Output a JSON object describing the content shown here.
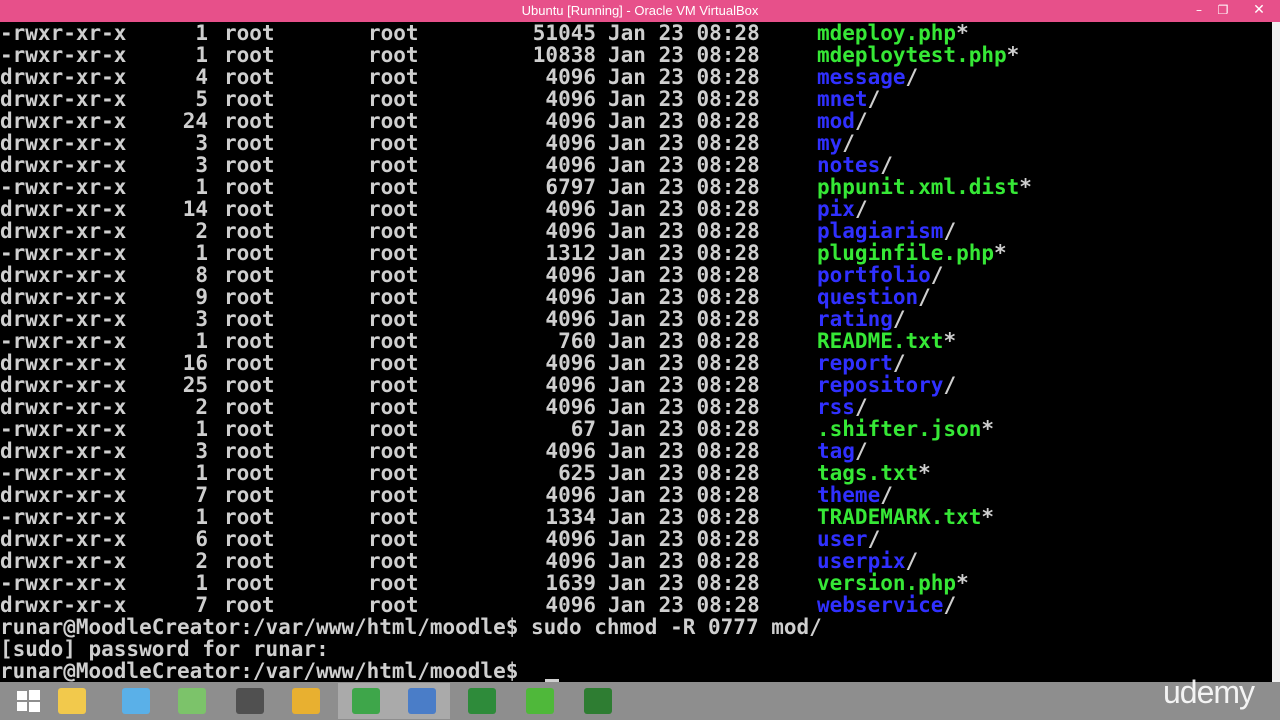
{
  "window": {
    "title": "Ubuntu [Running] - Oracle VM VirtualBox",
    "minimize_glyph": "–",
    "restore_glyph": "❐",
    "close_glyph": "✕"
  },
  "terminal": {
    "colors": {
      "directory": "#3030ff",
      "executable": "#36e836",
      "text": "#cfcfcf"
    },
    "listing": [
      {
        "perm": "-rwxr-xr-x",
        "links": "1",
        "owner": "root",
        "group": "root",
        "size": "51045",
        "date": "Jan 23 08:28",
        "name": "mdeploy.php",
        "suffix": "*",
        "type": "exec"
      },
      {
        "perm": "-rwxr-xr-x",
        "links": "1",
        "owner": "root",
        "group": "root",
        "size": "10838",
        "date": "Jan 23 08:28",
        "name": "mdeploytest.php",
        "suffix": "*",
        "type": "exec"
      },
      {
        "perm": "drwxr-xr-x",
        "links": "4",
        "owner": "root",
        "group": "root",
        "size": "4096",
        "date": "Jan 23 08:28",
        "name": "message",
        "suffix": "/",
        "type": "dir"
      },
      {
        "perm": "drwxr-xr-x",
        "links": "5",
        "owner": "root",
        "group": "root",
        "size": "4096",
        "date": "Jan 23 08:28",
        "name": "mnet",
        "suffix": "/",
        "type": "dir"
      },
      {
        "perm": "drwxr-xr-x",
        "links": "24",
        "owner": "root",
        "group": "root",
        "size": "4096",
        "date": "Jan 23 08:28",
        "name": "mod",
        "suffix": "/",
        "type": "dir"
      },
      {
        "perm": "drwxr-xr-x",
        "links": "3",
        "owner": "root",
        "group": "root",
        "size": "4096",
        "date": "Jan 23 08:28",
        "name": "my",
        "suffix": "/",
        "type": "dir"
      },
      {
        "perm": "drwxr-xr-x",
        "links": "3",
        "owner": "root",
        "group": "root",
        "size": "4096",
        "date": "Jan 23 08:28",
        "name": "notes",
        "suffix": "/",
        "type": "dir"
      },
      {
        "perm": "-rwxr-xr-x",
        "links": "1",
        "owner": "root",
        "group": "root",
        "size": "6797",
        "date": "Jan 23 08:28",
        "name": "phpunit.xml.dist",
        "suffix": "*",
        "type": "exec"
      },
      {
        "perm": "drwxr-xr-x",
        "links": "14",
        "owner": "root",
        "group": "root",
        "size": "4096",
        "date": "Jan 23 08:28",
        "name": "pix",
        "suffix": "/",
        "type": "dir"
      },
      {
        "perm": "drwxr-xr-x",
        "links": "2",
        "owner": "root",
        "group": "root",
        "size": "4096",
        "date": "Jan 23 08:28",
        "name": "plagiarism",
        "suffix": "/",
        "type": "dir"
      },
      {
        "perm": "-rwxr-xr-x",
        "links": "1",
        "owner": "root",
        "group": "root",
        "size": "1312",
        "date": "Jan 23 08:28",
        "name": "pluginfile.php",
        "suffix": "*",
        "type": "exec"
      },
      {
        "perm": "drwxr-xr-x",
        "links": "8",
        "owner": "root",
        "group": "root",
        "size": "4096",
        "date": "Jan 23 08:28",
        "name": "portfolio",
        "suffix": "/",
        "type": "dir"
      },
      {
        "perm": "drwxr-xr-x",
        "links": "9",
        "owner": "root",
        "group": "root",
        "size": "4096",
        "date": "Jan 23 08:28",
        "name": "question",
        "suffix": "/",
        "type": "dir"
      },
      {
        "perm": "drwxr-xr-x",
        "links": "3",
        "owner": "root",
        "group": "root",
        "size": "4096",
        "date": "Jan 23 08:28",
        "name": "rating",
        "suffix": "/",
        "type": "dir"
      },
      {
        "perm": "-rwxr-xr-x",
        "links": "1",
        "owner": "root",
        "group": "root",
        "size": "760",
        "date": "Jan 23 08:28",
        "name": "README.txt",
        "suffix": "*",
        "type": "exec"
      },
      {
        "perm": "drwxr-xr-x",
        "links": "16",
        "owner": "root",
        "group": "root",
        "size": "4096",
        "date": "Jan 23 08:28",
        "name": "report",
        "suffix": "/",
        "type": "dir"
      },
      {
        "perm": "drwxr-xr-x",
        "links": "25",
        "owner": "root",
        "group": "root",
        "size": "4096",
        "date": "Jan 23 08:28",
        "name": "repository",
        "suffix": "/",
        "type": "dir"
      },
      {
        "perm": "drwxr-xr-x",
        "links": "2",
        "owner": "root",
        "group": "root",
        "size": "4096",
        "date": "Jan 23 08:28",
        "name": "rss",
        "suffix": "/",
        "type": "dir"
      },
      {
        "perm": "-rwxr-xr-x",
        "links": "1",
        "owner": "root",
        "group": "root",
        "size": "67",
        "date": "Jan 23 08:28",
        "name": ".shifter.json",
        "suffix": "*",
        "type": "exec"
      },
      {
        "perm": "drwxr-xr-x",
        "links": "3",
        "owner": "root",
        "group": "root",
        "size": "4096",
        "date": "Jan 23 08:28",
        "name": "tag",
        "suffix": "/",
        "type": "dir"
      },
      {
        "perm": "-rwxr-xr-x",
        "links": "1",
        "owner": "root",
        "group": "root",
        "size": "625",
        "date": "Jan 23 08:28",
        "name": "tags.txt",
        "suffix": "*",
        "type": "exec"
      },
      {
        "perm": "drwxr-xr-x",
        "links": "7",
        "owner": "root",
        "group": "root",
        "size": "4096",
        "date": "Jan 23 08:28",
        "name": "theme",
        "suffix": "/",
        "type": "dir"
      },
      {
        "perm": "-rwxr-xr-x",
        "links": "1",
        "owner": "root",
        "group": "root",
        "size": "1334",
        "date": "Jan 23 08:28",
        "name": "TRADEMARK.txt",
        "suffix": "*",
        "type": "exec"
      },
      {
        "perm": "drwxr-xr-x",
        "links": "6",
        "owner": "root",
        "group": "root",
        "size": "4096",
        "date": "Jan 23 08:28",
        "name": "user",
        "suffix": "/",
        "type": "dir"
      },
      {
        "perm": "drwxr-xr-x",
        "links": "2",
        "owner": "root",
        "group": "root",
        "size": "4096",
        "date": "Jan 23 08:28",
        "name": "userpix",
        "suffix": "/",
        "type": "dir"
      },
      {
        "perm": "-rwxr-xr-x",
        "links": "1",
        "owner": "root",
        "group": "root",
        "size": "1639",
        "date": "Jan 23 08:28",
        "name": "version.php",
        "suffix": "*",
        "type": "exec"
      },
      {
        "perm": "drwxr-xr-x",
        "links": "7",
        "owner": "root",
        "group": "root",
        "size": "4096",
        "date": "Jan 23 08:28",
        "name": "webservice",
        "suffix": "/",
        "type": "dir"
      }
    ],
    "command_line": "runar@MoodleCreator:/var/www/html/moodle$ sudo chmod -R 0777 mod/",
    "sudo_prompt": "[sudo] password for runar:",
    "current_prompt": "runar@MoodleCreator:/var/www/html/moodle$ "
  },
  "taskbar": {
    "apps": [
      {
        "name": "windows-start-icon",
        "color": "#ffffff",
        "active": false
      },
      {
        "name": "file-explorer-icon",
        "color": "#f2c94c",
        "active": false
      },
      {
        "name": "globe-app-icon",
        "color": "#5ab0e8",
        "active": false
      },
      {
        "name": "notepad-icon",
        "color": "#7cc36a",
        "active": false
      },
      {
        "name": "monitor-app-icon",
        "color": "#505050",
        "active": false
      },
      {
        "name": "chrome-icon",
        "color": "#e8b030",
        "active": false
      },
      {
        "name": "camtasia-icon",
        "color": "#3ea64a",
        "active": true
      },
      {
        "name": "virtualbox-icon",
        "color": "#4a7dc8",
        "active": true
      },
      {
        "name": "spreadsheet-icon",
        "color": "#2e8b3a",
        "active": false
      },
      {
        "name": "utorrent-icon",
        "color": "#4fb83a",
        "active": false
      },
      {
        "name": "camtasia-recorder-icon",
        "color": "#2e7d32",
        "active": false
      }
    ]
  },
  "watermark": {
    "text": "udemy"
  }
}
